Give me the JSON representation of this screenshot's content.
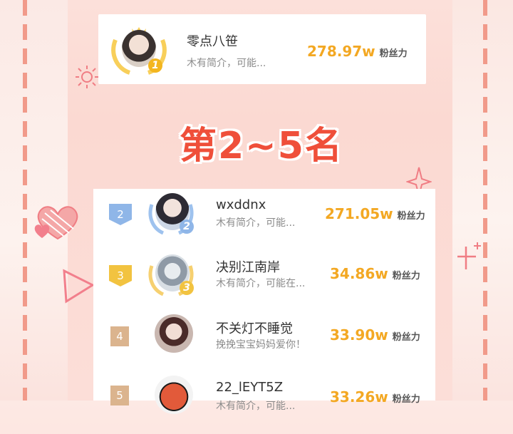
{
  "colors": {
    "accent": "#f3a823",
    "title": "#ef4f3a",
    "rank2": "#8fb6e8",
    "rank3": "#f2c340",
    "rank4": "#d2a377",
    "rank5": "#d2a377"
  },
  "top": {
    "name": "零点八笹",
    "desc": "木有简介，可能...",
    "fans": "278.97w",
    "unit": "粉丝力",
    "badge": "1"
  },
  "section_title": "第2~5名",
  "rows": [
    {
      "rank": "2",
      "name": "wxddnx",
      "desc": "木有简介，可能...",
      "fans": "271.05w",
      "unit": "粉丝力",
      "badge": "2"
    },
    {
      "rank": "3",
      "name": "决别江南岸",
      "desc": "木有简介，可能在...",
      "fans": "34.86w",
      "unit": "粉丝力",
      "badge": "3"
    },
    {
      "rank": "4",
      "name": "不关灯不睡觉",
      "desc": "挽挽宝宝妈妈爱你！",
      "fans": "33.90w",
      "unit": "粉丝力"
    },
    {
      "rank": "5",
      "name": "22_lEYT5Z",
      "desc": "木有简介，可能...",
      "fans": "33.26w",
      "unit": "粉丝力"
    }
  ]
}
